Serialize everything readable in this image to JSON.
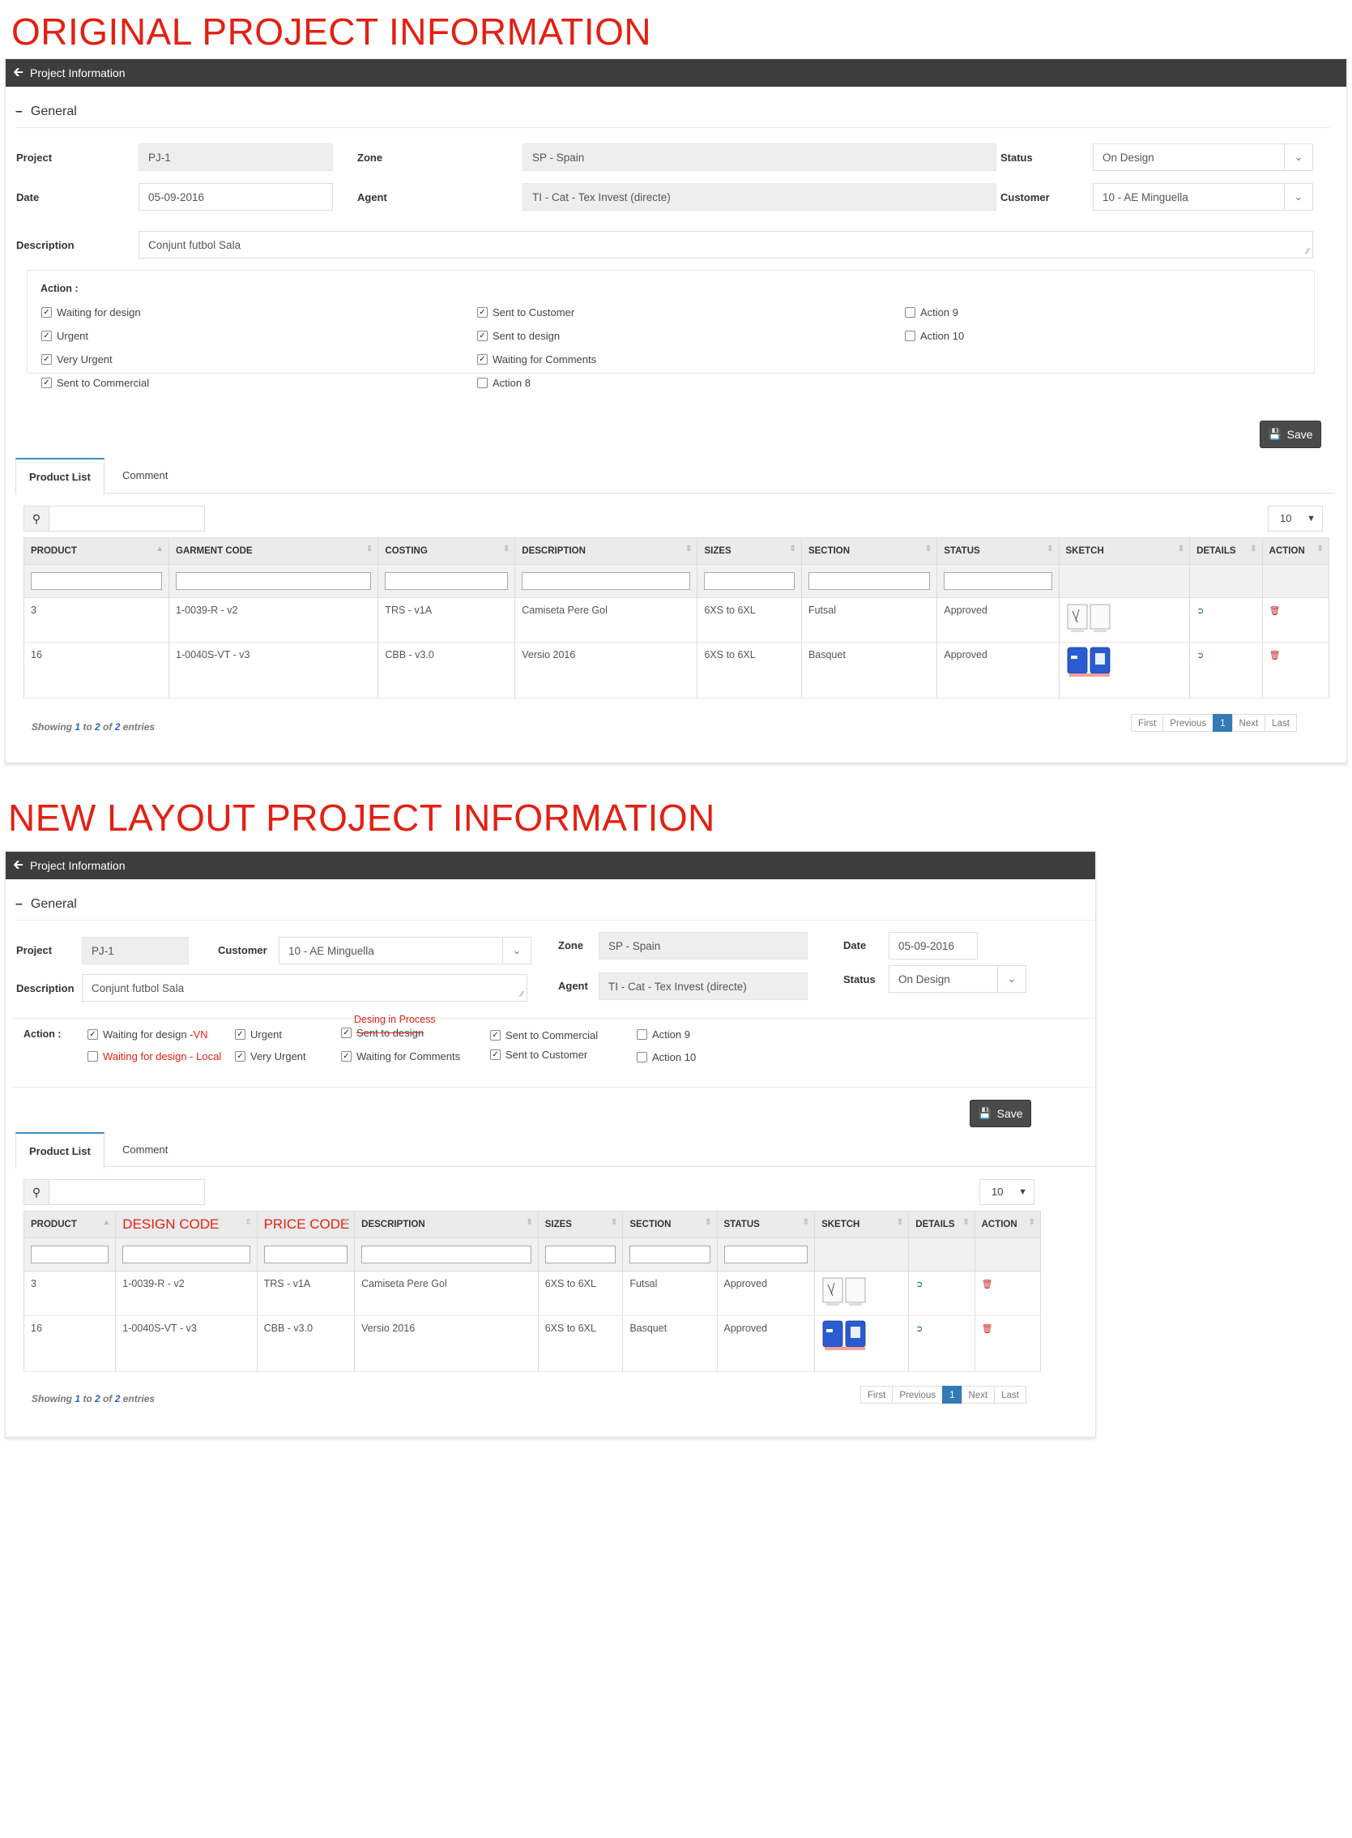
{
  "headings": {
    "original": "ORIGINAL PROJECT INFORMATION",
    "new_layout": "NEW LAYOUT PROJECT INFORMATION"
  },
  "colors": {
    "annotation_red": "#e32012",
    "header_bar": "#3d3d3d",
    "pager_active": "#337ab7"
  },
  "original": {
    "title": "Project Information",
    "section": "General",
    "fields": {
      "project_label": "Project",
      "project_value": "PJ-1",
      "zone_label": "Zone",
      "zone_value": "SP - Spain",
      "status_label": "Status",
      "status_value": "On Design",
      "date_label": "Date",
      "date_value": "05-09-2016",
      "agent_label": "Agent",
      "agent_value": "TI - Cat - Tex Invest (directe)",
      "customer_label": "Customer",
      "customer_value": "10 - AE Minguella",
      "description_label": "Description",
      "description_value": "Conjunt futbol Sala"
    },
    "action_label": "Action :",
    "actions": [
      {
        "label": "Waiting for design",
        "checked": true
      },
      {
        "label": "Urgent",
        "checked": true
      },
      {
        "label": "Very Urgent",
        "checked": true
      },
      {
        "label": "Sent to Commercial",
        "checked": true
      },
      {
        "label": "Sent to Customer",
        "checked": true
      },
      {
        "label": "Sent to design",
        "checked": true
      },
      {
        "label": "Waiting for Comments",
        "checked": true
      },
      {
        "label": "Action 8",
        "checked": false
      },
      {
        "label": "Action 9",
        "checked": false
      },
      {
        "label": "Action 10",
        "checked": false
      }
    ],
    "save_label": "Save",
    "tabs": [
      "Product List",
      "Comment"
    ],
    "page_length": "10",
    "columns": [
      "PRODUCT",
      "GARMENT CODE",
      "COSTING",
      "DESCRIPTION",
      "SIZES",
      "SECTION",
      "STATUS",
      "SKETCH",
      "DETAILS",
      "ACTION"
    ],
    "rows": [
      {
        "product": "3",
        "code": "1-0039-R - v2",
        "costing": "TRS - v1A",
        "description": "Camiseta Pere Gol",
        "sizes": "6XS to 6XL",
        "section": "Futsal",
        "status": "Approved"
      },
      {
        "product": "16",
        "code": "1-0040S-VT - v3",
        "costing": "CBB - v3.0",
        "description": "Versio 2016",
        "sizes": "6XS to 6XL",
        "section": "Basquet",
        "status": "Approved"
      }
    ],
    "showing": {
      "pre": "Showing ",
      "from": "1",
      "to_word": " to ",
      "to": "2",
      "of_word": " of ",
      "total": "2",
      "post": " entries"
    },
    "pager": [
      "First",
      "Previous",
      "1",
      "Next",
      "Last"
    ]
  },
  "new": {
    "title": "Project Information",
    "section": "General",
    "fields": {
      "project_label": "Project",
      "project_value": "PJ-1",
      "customer_label": "Customer",
      "customer_value": "10 - AE Minguella",
      "zone_label": "Zone",
      "zone_value": "SP - Spain",
      "date_label": "Date",
      "date_value": "05-09-2016",
      "description_label": "Description",
      "description_value": "Conjunt futbol Sala",
      "agent_label": "Agent",
      "agent_value": "TI - Cat - Tex Invest (directe)",
      "status_label": "Status",
      "status_value": "On Design"
    },
    "action_label": "Action :",
    "actions": {
      "waiting_design_prefix": "Waiting for design - ",
      "waiting_design_suffix": "VN",
      "waiting_design_local": "Waiting for design - Local",
      "urgent": "Urgent",
      "very_urgent": "Very Urgent",
      "desing_in_process": "Desing in Process",
      "sent_to_design": "Sent to design",
      "waiting_comments": "Waiting for Comments",
      "sent_commercial": "Sent to Commercial",
      "sent_customer": "Sent to Customer",
      "action9": "Action 9",
      "action10": "Action 10"
    },
    "save_label": "Save",
    "tabs": [
      "Product List",
      "Comment"
    ],
    "page_length": "10",
    "columns": [
      "PRODUCT",
      "DESIGN CODE",
      "PRICE CODE",
      "DESCRIPTION",
      "SIZES",
      "SECTION",
      "STATUS",
      "SKETCH",
      "DETAILS",
      "ACTION"
    ],
    "rows": [
      {
        "product": "3",
        "code": "1-0039-R - v2",
        "costing": "TRS - v1A",
        "description": "Camiseta Pere Gol",
        "sizes": "6XS to 6XL",
        "section": "Futsal",
        "status": "Approved"
      },
      {
        "product": "16",
        "code": "1-0040S-VT - v3",
        "costing": "CBB - v3.0",
        "description": "Versio 2016",
        "sizes": "6XS to 6XL",
        "section": "Basquet",
        "status": "Approved"
      }
    ],
    "showing": {
      "pre": "Showing ",
      "from": "1",
      "to_word": " to ",
      "to": "2",
      "of_word": " of ",
      "total": "2",
      "post": " entries"
    },
    "pager": [
      "First",
      "Previous",
      "1",
      "Next",
      "Last"
    ]
  }
}
